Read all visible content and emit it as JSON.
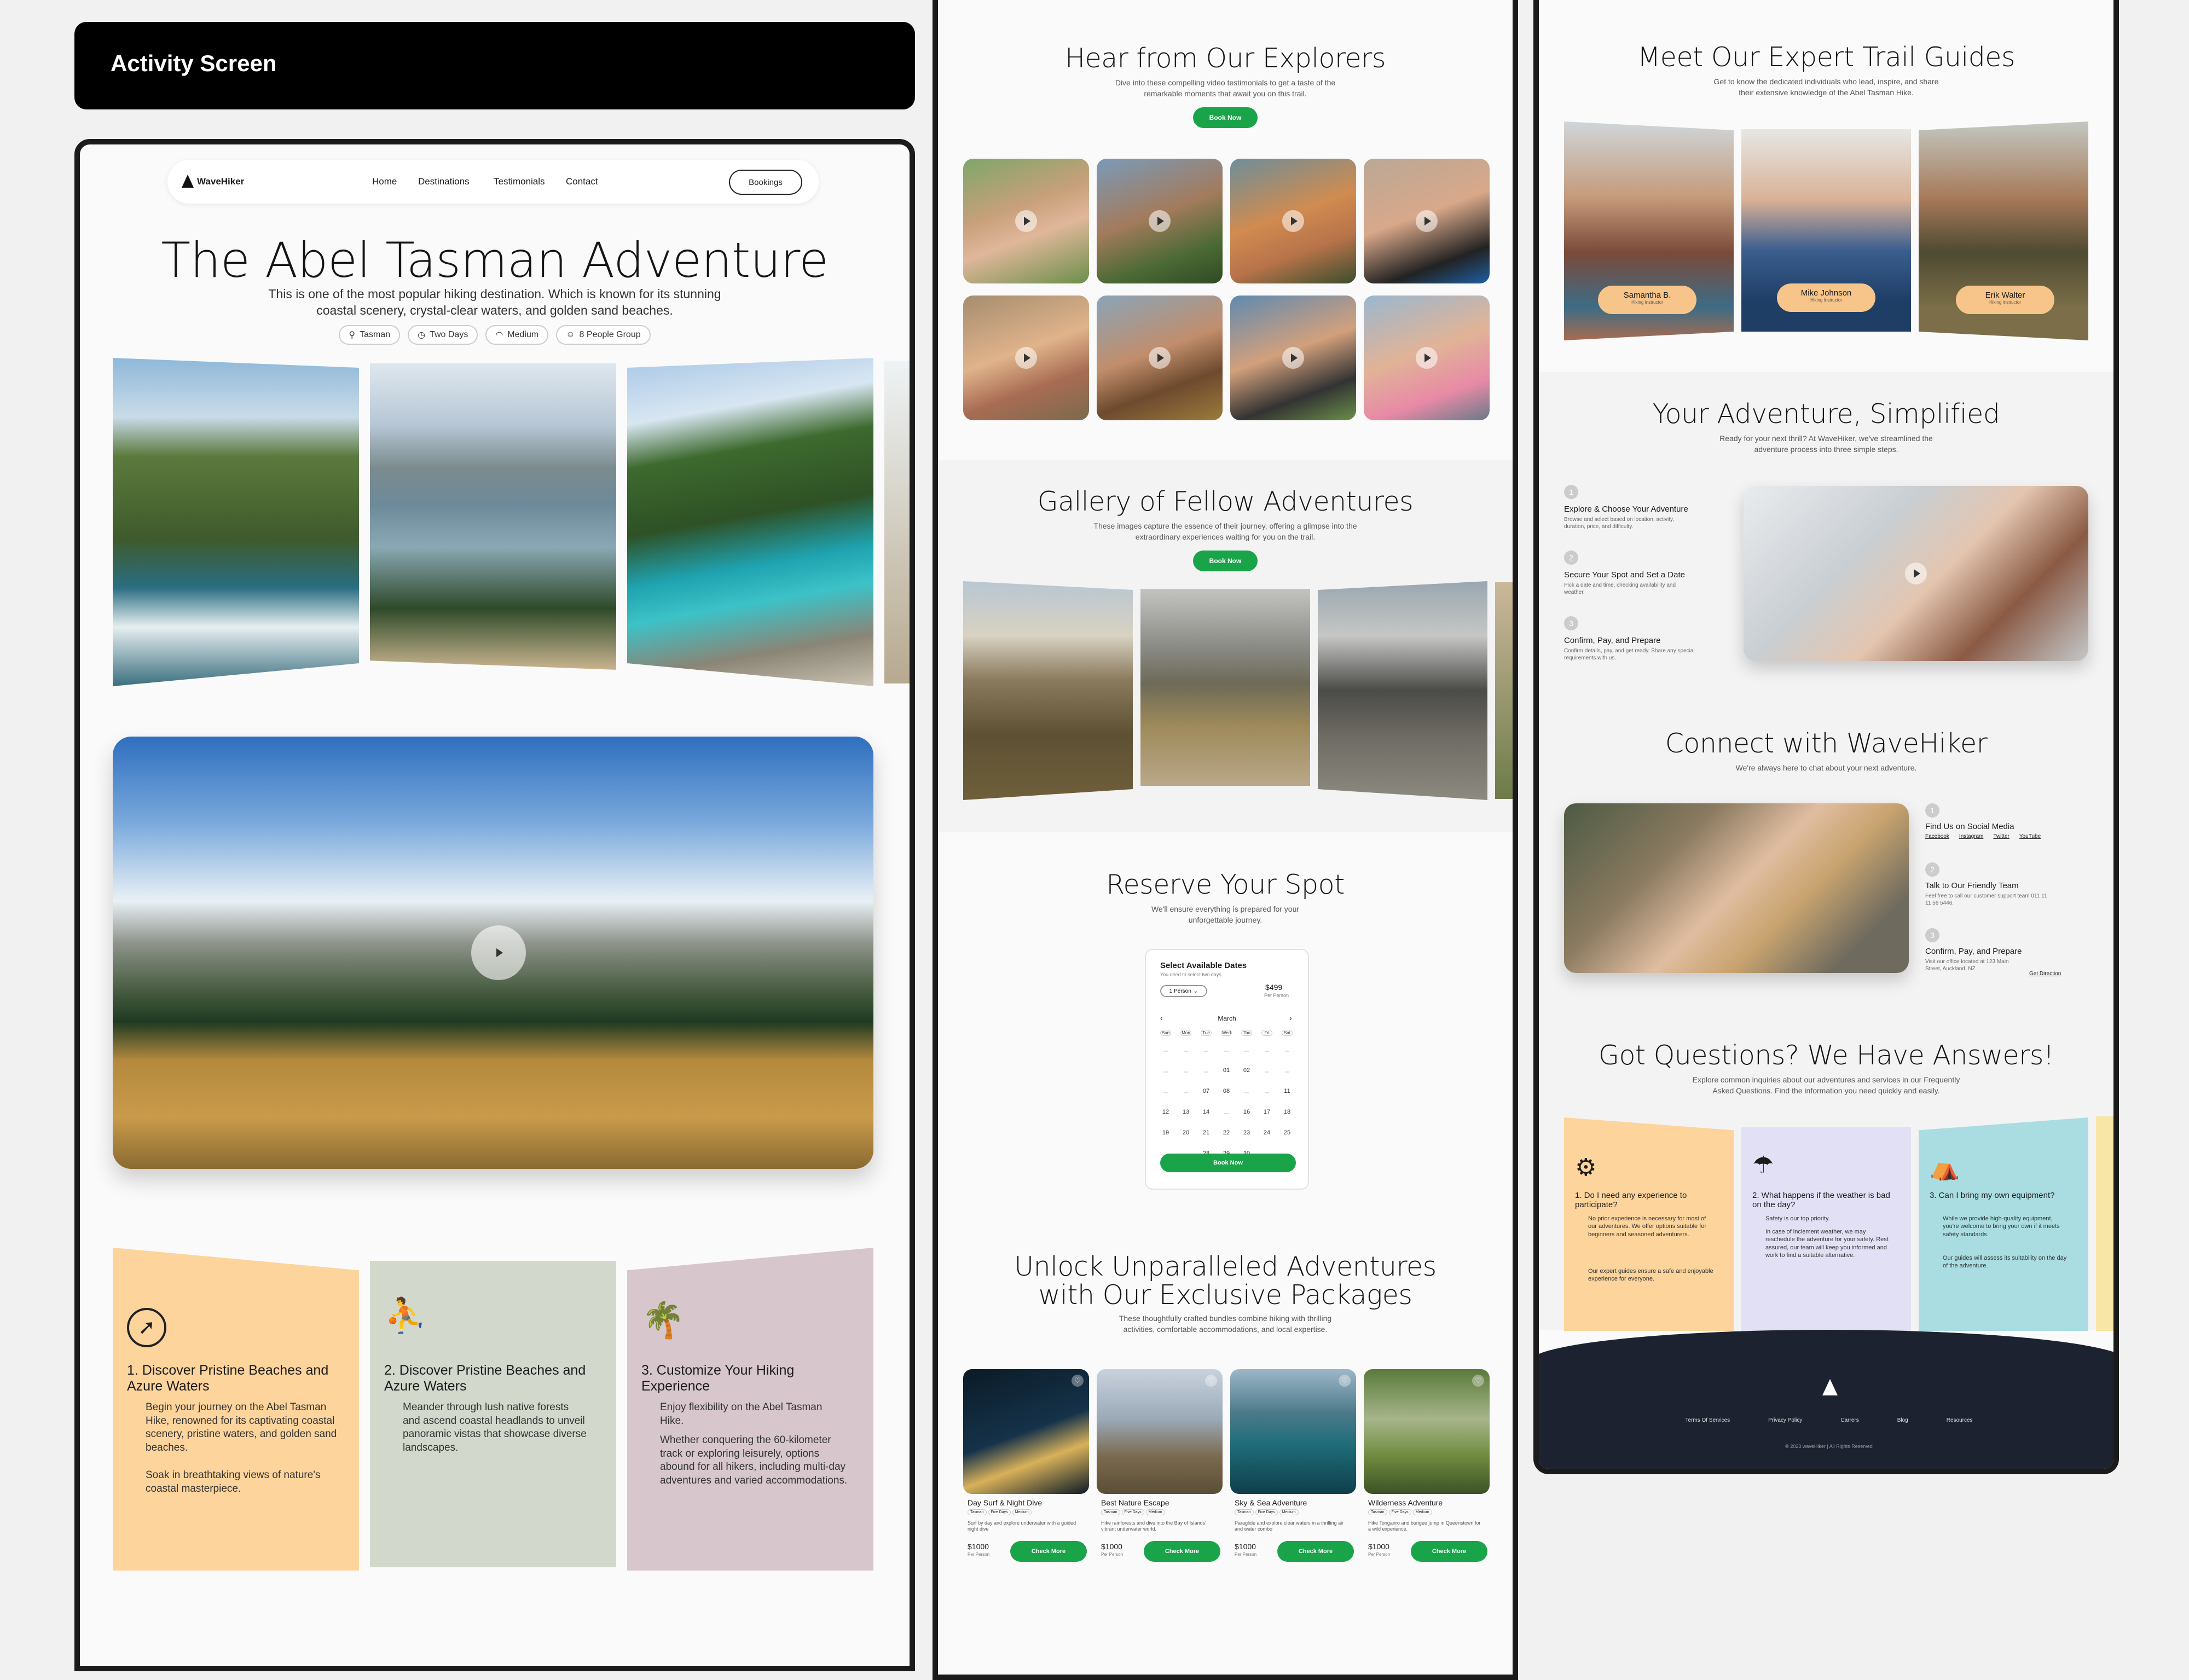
{
  "header": {
    "title": "Activity Screen"
  },
  "screen1": {
    "brand": "WaveHiker",
    "nav": [
      "Home",
      "Destinations",
      "Testimonials",
      "Contact"
    ],
    "bookings": "Bookings",
    "hero_title": "The Abel Tasman Adventure",
    "hero_desc_1": "This is one of the most popular hiking destination. Which is known for its stunning",
    "hero_desc_2": "coastal scenery, crystal-clear waters, and golden sand beaches.",
    "tags": [
      {
        "icon": "pin-icon",
        "label": "Tasman"
      },
      {
        "icon": "clock-icon",
        "label": "Two Days"
      },
      {
        "icon": "gauge-icon",
        "label": "Medium"
      },
      {
        "icon": "person-icon",
        "label": "8 People Group"
      }
    ],
    "features": [
      {
        "icon": "compass-icon",
        "title": "1. Discover Pristine Beaches and Azure Waters",
        "p1": "Begin your journey on the Abel Tasman Hike, renowned for its captivating coastal scenery, pristine waters, and golden sand beaches.",
        "p2": "Soak in breathtaking views of nature's coastal masterpiece.",
        "color": "#fcd49c"
      },
      {
        "icon": "hiker-tree-icon",
        "title": "2. Discover Pristine Beaches and Azure Waters",
        "p1": "Meander through lush native forests and ascend coastal headlands to unveil panoramic vistas that showcase diverse landscapes.",
        "p2": "",
        "color": "#d2d9cc"
      },
      {
        "icon": "palm-tree-icon",
        "title": "3. Customize Your Hiking Experience",
        "p1": "Enjoy flexibility on the Abel Tasman Hike.",
        "p2": "Whether conquering the 60-kilometer track or exploring leisurely, options abound for all hikers, including multi-day adventures and varied accommodations.",
        "color": "#d7c7cc"
      }
    ]
  },
  "screen2": {
    "explorers_title": "Hear from Our Explorers",
    "explorers_sub_1": "Dive into these compelling video testimonials to get a taste of the",
    "explorers_sub_2": "remarkable moments that await you on this trail.",
    "book_now": "Book Now",
    "gallery_title": "Gallery of Fellow Adventures",
    "gallery_sub_1": "These images capture the essence of their journey, offering a glimpse into the",
    "gallery_sub_2": "extraordinary experiences waiting for you on the trail.",
    "reserve_title": "Reserve Your Spot",
    "reserve_sub_1": "We'll ensure everything is prepared for your",
    "reserve_sub_2": "unforgettable journey.",
    "calendar": {
      "title": "Select Available Dates",
      "hint": "You need to select two days.",
      "persons": "1 Person",
      "price": "$499",
      "price_unit": "Per Person",
      "month": "March",
      "weekdays": [
        "Sun",
        "Mon",
        "Tue",
        "Wed",
        "Thu",
        "Fri",
        "Sat"
      ],
      "rows": [
        [
          "",
          "",
          "",
          "",
          "",
          "",
          ""
        ],
        [
          "",
          "",
          "",
          "01",
          "02",
          "",
          ""
        ],
        [
          "",
          "",
          "07",
          "08",
          "",
          "",
          "11"
        ],
        [
          "12",
          "13",
          "14",
          "",
          "16",
          "17",
          "18"
        ],
        [
          "19",
          "20",
          "21",
          "22",
          "23",
          "24",
          "25"
        ],
        [
          "",
          "",
          "28",
          "29",
          "30",
          "",
          ""
        ]
      ],
      "book": "Book Now"
    },
    "packages_title_1": "Unlock Unparalleled Adventures",
    "packages_title_2": "with Our Exclusive Packages",
    "packages_sub_1": "These thoughtfully crafted bundles combine hiking with thrilling",
    "packages_sub_2": "activities, comfortable accommodations, and local expertise.",
    "packages": [
      {
        "name": "Day Surf & Night Dive",
        "desc": "Surf by day and explore underwater with a guided night dive",
        "price": "$1000",
        "unit": "Per Person",
        "cta": "Check More"
      },
      {
        "name": "Best Nature Escape",
        "desc": "Hike rainforests and dive into the Bay of Islands' vibrant underwater world.",
        "price": "$1000",
        "unit": "Per Person",
        "cta": "Check More"
      },
      {
        "name": "Sky & Sea Adventure",
        "desc": "Paraglide and explore clear waters in a thrilling air and water combo",
        "price": "$1000",
        "unit": "Per Person",
        "cta": "Check More"
      },
      {
        "name": "Wilderness Adventure",
        "desc": "Hike Tongariro and bungee jump in Queenstown for a wild experience.",
        "price": "$1000",
        "unit": "Per Person",
        "cta": "Check More"
      }
    ],
    "package_tags": [
      "Tasman",
      "Five Days",
      "Medium"
    ]
  },
  "screen3": {
    "guides_title": "Meet Our Expert Trail Guides",
    "guides_sub_1": "Get to know the dedicated individuals who lead, inspire, and share",
    "guides_sub_2": "their extensive knowledge of the Abel Tasman Hike.",
    "guides": [
      {
        "name": "Samantha B.",
        "role": "Hiking Instructor"
      },
      {
        "name": "Mike Johnson",
        "role": "Hiking Instructor"
      },
      {
        "name": "Erik Walter",
        "role": "Hiking Instructor"
      }
    ],
    "simple_title": "Your Adventure, Simplified",
    "simple_sub_1": "Ready for your next thrill? At WaveHiker, we've streamlined the",
    "simple_sub_2": "adventure process into three simple steps.",
    "steps": [
      {
        "n": "1",
        "title": "Explore & Choose Your Adventure",
        "desc": "Browse and select based on location, activity, duration, price, and difficulty."
      },
      {
        "n": "2",
        "title": "Secure Your Spot and Set a Date",
        "desc": "Pick a date and time, checking availability and weather."
      },
      {
        "n": "3",
        "title": "Confirm, Pay, and Prepare",
        "desc": "Confirm details, pay, and get ready. Share any special requirements with us."
      }
    ],
    "connect_title": "Connect with WaveHiker",
    "connect_sub": "We're always here to chat about your next adventure.",
    "connect": [
      {
        "n": "1",
        "title": "Find Us on Social Media",
        "links": [
          "Facebook",
          "Instagram",
          "Twitter",
          "YouTube"
        ],
        "desc": ""
      },
      {
        "n": "2",
        "title": "Talk to Our Friendly Team",
        "links": [],
        "desc": "Feel free to call our customer support team 011 11 11 56 5446."
      },
      {
        "n": "3",
        "title": "Confirm, Pay, and Prepare",
        "links": [
          "Get Direction"
        ],
        "desc": "Visit our office located at 123 Main Street, Auckland, NZ"
      }
    ],
    "faq_title": "Got Questions? We Have Answers!",
    "faq_sub_1": "Explore common inquiries about our adventures and services in our Frequently",
    "faq_sub_2": "Asked Questions. Find the information you need quickly and easily.",
    "faqs": [
      {
        "icon": "head-gear-icon",
        "q": "1. Do I need any experience to participate?",
        "a1": "No prior experience is necessary for most of our adventures. We offer options suitable for beginners and seasoned adventurers.",
        "a2": "Our expert guides ensure a safe and enjoyable experience for everyone.",
        "color": "#fcd49c"
      },
      {
        "icon": "umbrella-rain-icon",
        "q": "2. What happens if the weather is bad on the day?",
        "a1": "Safety is our top priority.",
        "a2": "In case of inclement weather, we may reschedule the adventure for your safety. Rest assured, our team will keep you informed and work to find a suitable alternative.",
        "color": "#e2e0f4"
      },
      {
        "icon": "tent-icon",
        "q": "3. Can I bring my own equipment?",
        "a1": "While we provide high-quality equipment, you're welcome to bring your own if it meets safety standards.",
        "a2": "Our guides will assess its suitability on the day of the adventure.",
        "color": "#a9dde1"
      }
    ],
    "footer_links": [
      "Terms Of Services",
      "Privacy Policy",
      "Carrers",
      "Blog",
      "Resources"
    ],
    "copyright": "© 2023 waveHiker | All Rights Reserved"
  }
}
